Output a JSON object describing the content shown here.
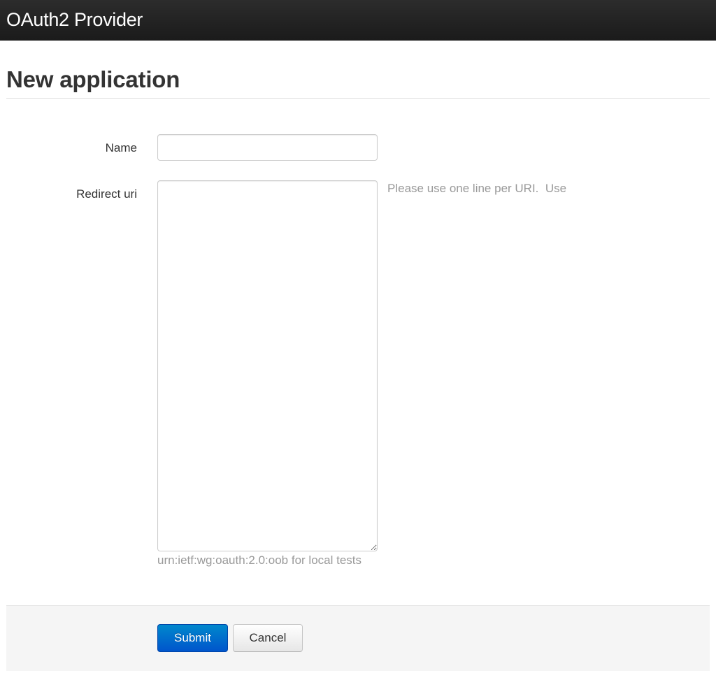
{
  "navbar": {
    "brand": "OAuth2 Provider"
  },
  "page": {
    "title": "New application"
  },
  "form": {
    "name": {
      "label": "Name",
      "value": ""
    },
    "redirect_uri": {
      "label": "Redirect uri",
      "value": "",
      "help_inline": "Please use one line per URI.  Use",
      "help_block": "urn:ietf:wg:oauth:2.0:oob for local tests"
    },
    "actions": {
      "submit_label": "Submit",
      "cancel_label": "Cancel"
    }
  },
  "colors": {
    "navbar_bg": "#1b1b1b",
    "primary_button": "#0074cc",
    "help_text": "#999999",
    "form_actions_bg": "#f5f5f5"
  }
}
